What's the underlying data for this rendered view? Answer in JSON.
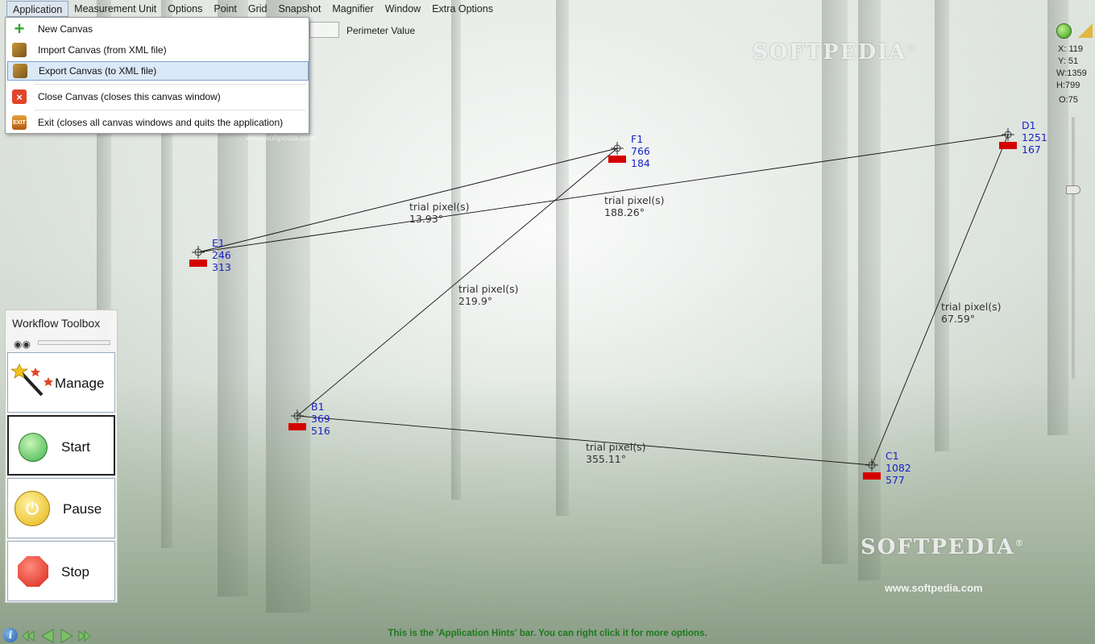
{
  "menu": {
    "items": [
      "Application",
      "Measurement Unit",
      "Options",
      "Point",
      "Grid",
      "Snapshot",
      "Magnifier",
      "Window",
      "Extra Options"
    ]
  },
  "application_menu": {
    "new_canvas": "New Canvas",
    "import_canvas": "Import Canvas (from XML file)",
    "export_canvas": "Export Canvas (to XML file)",
    "close_canvas": "Close Canvas (closes this canvas window)",
    "exit": "Exit (closes all canvas windows and quits the application)"
  },
  "perimeter_label": "Perimeter Value",
  "watermark": {
    "brand": "SOFTPEDIA",
    "registered": "®",
    "url_small": "www.softpedia.com",
    "url_large": "www.softpedia.com"
  },
  "status": {
    "x": "X: 119",
    "y": "Y: 51",
    "w": "W:1359",
    "h": "H:799",
    "o": "O:75"
  },
  "points": {
    "e1": {
      "name": "E1",
      "x": "246",
      "y": "313"
    },
    "f1": {
      "name": "F1",
      "x": "766",
      "y": "184"
    },
    "d1": {
      "name": "D1",
      "x": "1251",
      "y": "167"
    },
    "b1": {
      "name": "B1",
      "x": "369",
      "y": "516"
    },
    "c1": {
      "name": "C1",
      "x": "1082",
      "y": "577"
    }
  },
  "segments": {
    "ef": {
      "unit": "trial pixel(s)",
      "angle": "13.93°"
    },
    "ed": {
      "unit": "trial pixel(s)",
      "angle": "188.26°"
    },
    "bf": {
      "unit": "trial pixel(s)",
      "angle": "219.9°"
    },
    "cd": {
      "unit": "trial pixel(s)",
      "angle": "67.59°"
    },
    "bc": {
      "unit": "trial pixel(s)",
      "angle": "355.11°"
    }
  },
  "toolbox": {
    "title": "Workflow Toolbox",
    "manage": "Manage",
    "start": "Start",
    "pause": "Pause",
    "stop": "Stop"
  },
  "hint_bar": "This is the 'Application Hints' bar. You can right click it for more options.",
  "colors": {
    "point_label": "#1a22c8",
    "point_marker": "#d40000",
    "hint_text": "#1c7a1c"
  }
}
